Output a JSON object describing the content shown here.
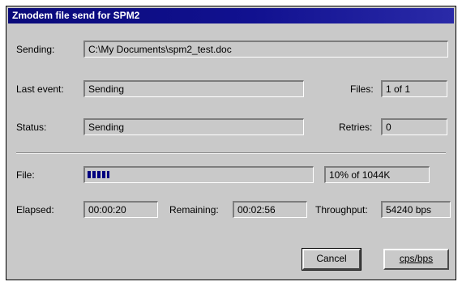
{
  "window": {
    "title": "Zmodem file send for SPM2"
  },
  "sending": {
    "label": "Sending:",
    "value": "C:\\My Documents\\spm2_test.doc"
  },
  "last_event": {
    "label": "Last event:",
    "value": "Sending"
  },
  "files": {
    "label": "Files:",
    "value": "1 of 1"
  },
  "status": {
    "label": "Status:",
    "value": "Sending"
  },
  "retries": {
    "label": "Retries:",
    "value": "0"
  },
  "file": {
    "label": "File:",
    "progress_fraction": 0.1,
    "progress_text": "10% of 1044K"
  },
  "elapsed": {
    "label": "Elapsed:",
    "value": "00:00:20"
  },
  "remaining": {
    "label": "Remaining:",
    "value": "00:02:56"
  },
  "throughput": {
    "label": "Throughput:",
    "value": "54240 bps"
  },
  "buttons": {
    "cancel": "Cancel",
    "cps": "cps/bps"
  },
  "colors": {
    "titlebar": "#111190",
    "progress": "#000080",
    "face": "#c9c9c9"
  }
}
